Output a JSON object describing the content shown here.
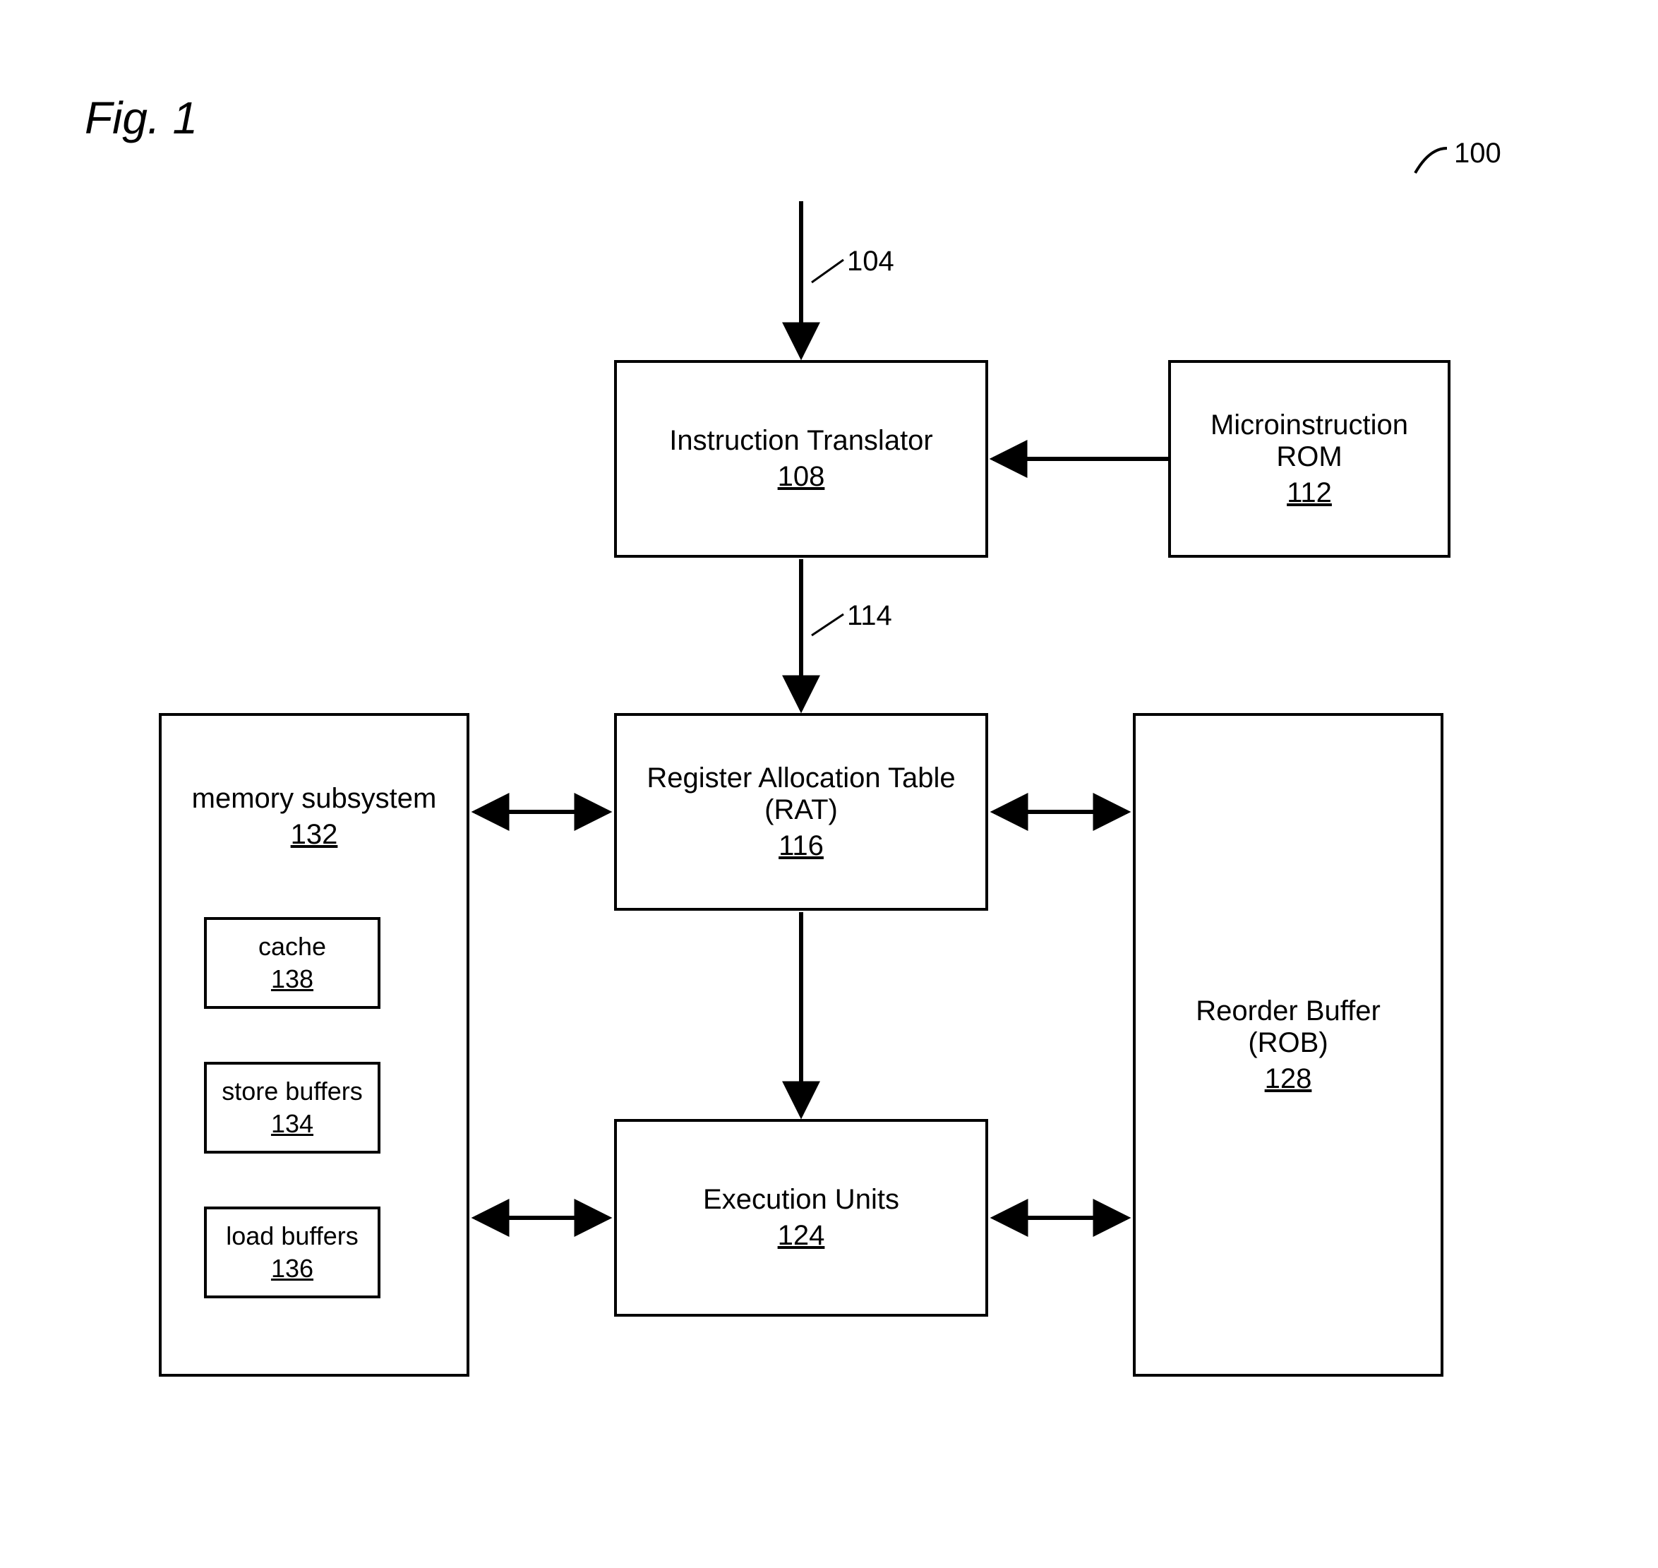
{
  "figure": {
    "title": "Fig. 1"
  },
  "refs": {
    "ref100": "100",
    "ref104": "104",
    "ref114": "114"
  },
  "blocks": {
    "instruction_translator": {
      "title": "Instruction Translator",
      "num": "108"
    },
    "microinstruction_rom": {
      "title1": "Microinstruction",
      "title2": "ROM",
      "num": "112"
    },
    "rat": {
      "title1": "Register Allocation Table",
      "title2": "(RAT)",
      "num": "116"
    },
    "execution_units": {
      "title": "Execution Units",
      "num": "124"
    },
    "rob": {
      "title1": "Reorder Buffer",
      "title2": "(ROB)",
      "num": "128"
    },
    "memory_subsystem": {
      "title": "memory subsystem",
      "num": "132"
    },
    "cache": {
      "title": "cache",
      "num": "138"
    },
    "store_buffers": {
      "title": "store buffers",
      "num": "134"
    },
    "load_buffers": {
      "title": "load buffers",
      "num": "136"
    }
  }
}
